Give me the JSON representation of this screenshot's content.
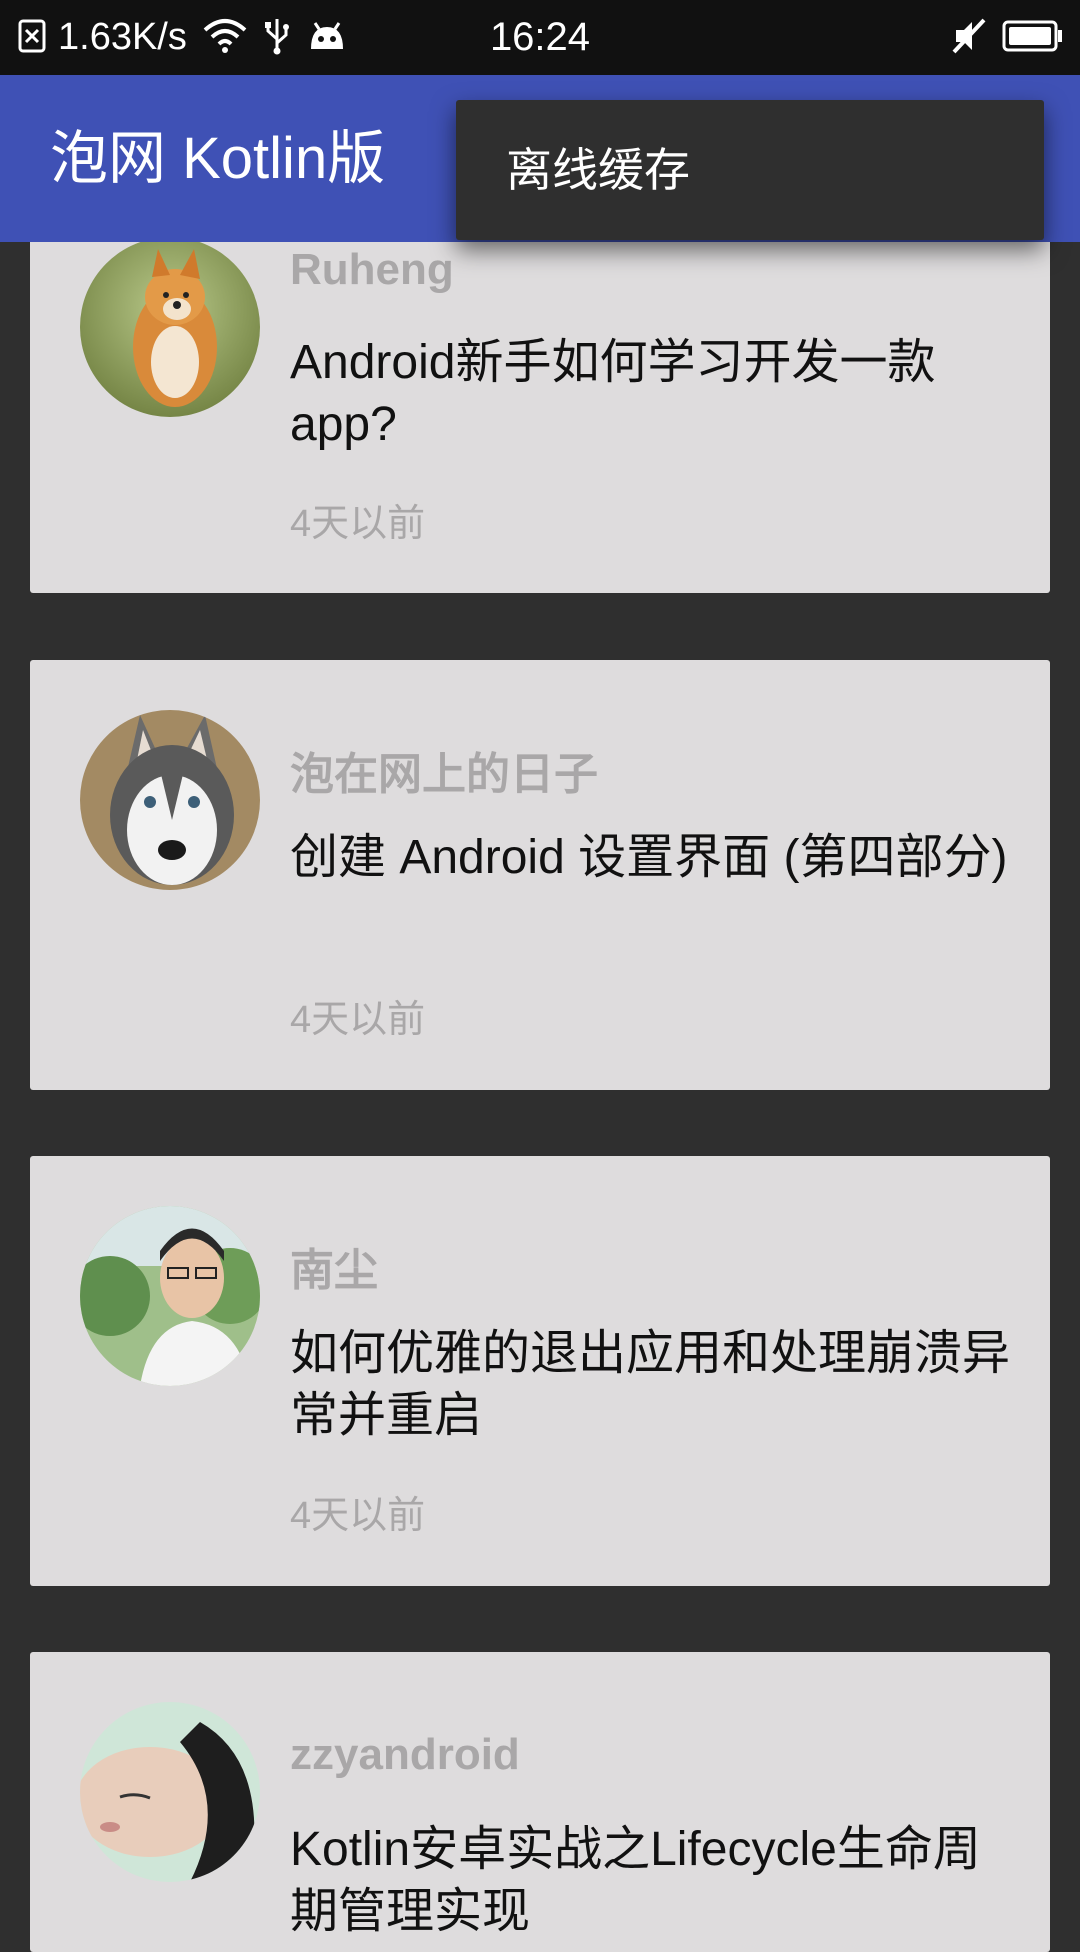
{
  "status_bar": {
    "net_speed": "1.63K/s",
    "time": "16:24",
    "icons_left": [
      "sim-error-icon",
      "wifi-icon",
      "usb-icon",
      "android-debug-icon"
    ],
    "icons_right": [
      "mute-icon",
      "battery-icon"
    ]
  },
  "toolbar": {
    "title": "泡网 Kotlin版",
    "color": "#3F51B5"
  },
  "popup_menu": {
    "items": [
      {
        "label": "离线缓存"
      }
    ]
  },
  "feed": {
    "items": [
      {
        "author": "Ruheng",
        "title": "Android新手如何学习开发一款app?",
        "time": "4天以前",
        "avatar": "shiba-dog"
      },
      {
        "author": "泡在网上的日子",
        "title": "创建 Android 设置界面 (第四部分)",
        "time": "4天以前",
        "avatar": "husky-dog"
      },
      {
        "author": "南尘",
        "title": "如何优雅的退出应用和处理崩溃异常并重启",
        "time": "4天以前",
        "avatar": "man-portrait"
      },
      {
        "author": "zzyandroid",
        "title": "Kotlin安卓实战之Lifecycle生命周期管理实现",
        "time": "",
        "avatar": "woman-portrait"
      }
    ]
  }
}
